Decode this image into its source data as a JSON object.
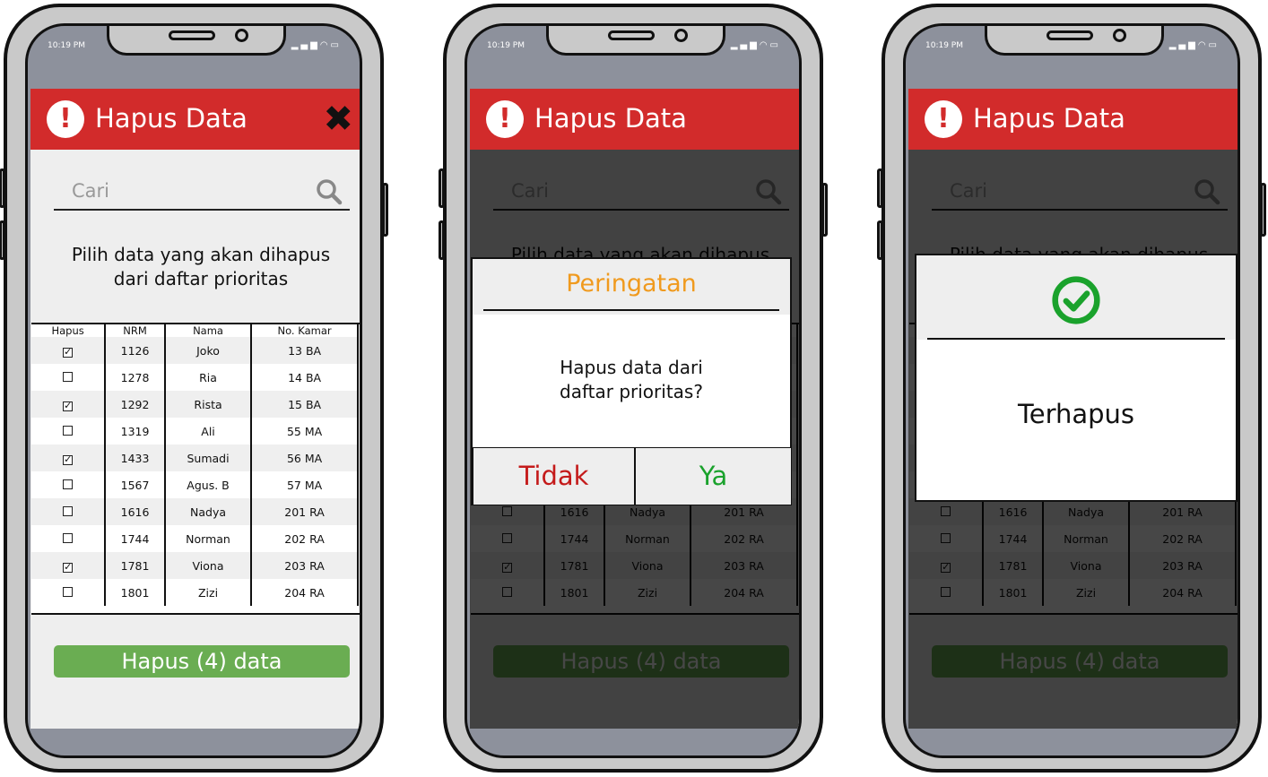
{
  "status": {
    "time": "10:19 PM"
  },
  "header": {
    "title": "Hapus Data"
  },
  "search": {
    "placeholder": "Cari"
  },
  "prompt": {
    "line1": "Pilih data yang akan dihapus",
    "line2": "dari daftar prioritas"
  },
  "table": {
    "headers": [
      "Hapus",
      "NRM",
      "Nama",
      "No. Kamar"
    ],
    "rows": [
      {
        "checked": true,
        "nrm": "1126",
        "nama": "Joko",
        "kamar": "13 BA"
      },
      {
        "checked": false,
        "nrm": "1278",
        "nama": "Ria",
        "kamar": "14 BA"
      },
      {
        "checked": true,
        "nrm": "1292",
        "nama": "Rista",
        "kamar": "15 BA"
      },
      {
        "checked": false,
        "nrm": "1319",
        "nama": "Ali",
        "kamar": "55 MA"
      },
      {
        "checked": true,
        "nrm": "1433",
        "nama": "Sumadi",
        "kamar": "56 MA"
      },
      {
        "checked": false,
        "nrm": "1567",
        "nama": "Agus. B",
        "kamar": "57 MA"
      },
      {
        "checked": false,
        "nrm": "1616",
        "nama": "Nadya",
        "kamar": "201 RA"
      },
      {
        "checked": false,
        "nrm": "1744",
        "nama": "Norman",
        "kamar": "202 RA"
      },
      {
        "checked": true,
        "nrm": "1781",
        "nama": "Viona",
        "kamar": "203 RA"
      },
      {
        "checked": false,
        "nrm": "1801",
        "nama": "Zizi",
        "kamar": "204 RA"
      }
    ]
  },
  "delete_button": {
    "label": "Hapus (4) data"
  },
  "confirm_dialog": {
    "title": "Peringatan",
    "message_line1": "Hapus data dari",
    "message_line2": "daftar prioritas?",
    "no_label": "Tidak",
    "yes_label": "Ya"
  },
  "success_dialog": {
    "message": "Terhapus"
  },
  "colors": {
    "header": "#d22b2b",
    "primary_button": "#6aad52",
    "warning_title": "#f09a1e",
    "no_button_text": "#c41a1a",
    "yes_button_text": "#1aa22c",
    "success_icon": "#1aa22c"
  },
  "icons": {
    "header": "exclamation-circle-icon",
    "close": "close-x-icon",
    "search": "magnifier-icon",
    "success": "check-circle-icon"
  }
}
